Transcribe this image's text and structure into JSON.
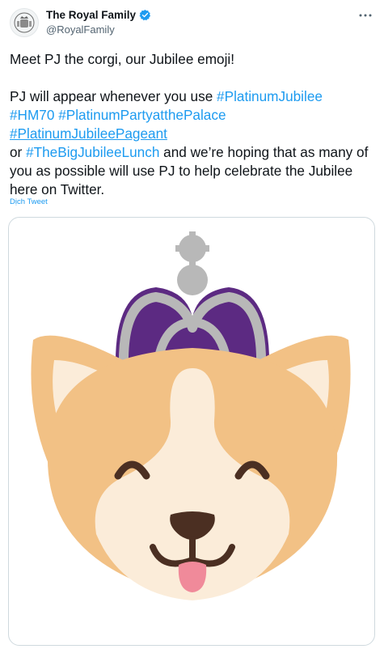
{
  "account": {
    "display_name": "The Royal Family",
    "handle": "@RoyalFamily",
    "avatar_icon": "royal-crest-icon",
    "verified_icon": "verified-badge-icon"
  },
  "more_icon": "more-options-icon",
  "tweet": {
    "paragraph1": "Meet PJ the corgi, our Jubilee emoji!",
    "p2_text1": "PJ will appear whenever you use ",
    "hashtag1": "#PlatinumJubilee",
    "hashtag2": "#HM70",
    "hashtag3": "#PlatinumPartyatthePalace",
    "hashtag4": "#PlatinumJubileePageant",
    "p2_text2": "or ",
    "hashtag5": "#TheBigJubileeLunch",
    "p2_text3": " and we’re hoping that as many of you as possible will use PJ to help celebrate the Jubilee here on Twitter."
  },
  "translate_label": "Dịch Tweet",
  "media": {
    "icon": "pj-corgi-jubilee-emoji-image"
  },
  "colors": {
    "link": "#1d9bf0",
    "crown_purple": "#5c2a82",
    "crown_silver": "#b8b8b8",
    "corgi_orange": "#f2c185",
    "corgi_cream": "#fbecd9"
  }
}
